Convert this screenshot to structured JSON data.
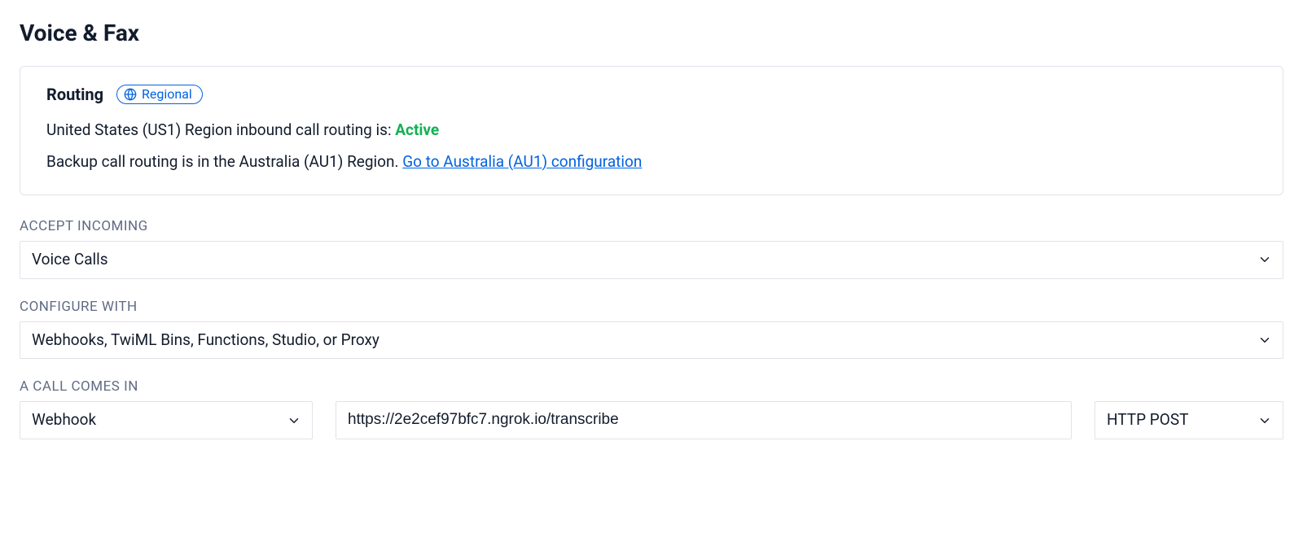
{
  "page": {
    "title": "Voice & Fax"
  },
  "routing": {
    "title": "Routing",
    "badge_label": "Regional",
    "line1_prefix": "United States (US1) Region inbound call routing is: ",
    "line1_status": "Active",
    "line2_text": "Backup call routing is in the Australia (AU1) Region.  ",
    "line2_link": "Go to Australia (AU1) configuration"
  },
  "accept_incoming": {
    "label": "ACCEPT INCOMING",
    "value": "Voice Calls"
  },
  "configure_with": {
    "label": "CONFIGURE WITH",
    "value": "Webhooks, TwiML Bins, Functions, Studio, or Proxy"
  },
  "call_comes_in": {
    "label": "A CALL COMES IN",
    "handler_value": "Webhook",
    "url_value": "https://2e2cef97bfc7.ngrok.io/transcribe",
    "method_value": "HTTP POST"
  },
  "colors": {
    "link": "#0263e0",
    "success": "#14b053"
  }
}
